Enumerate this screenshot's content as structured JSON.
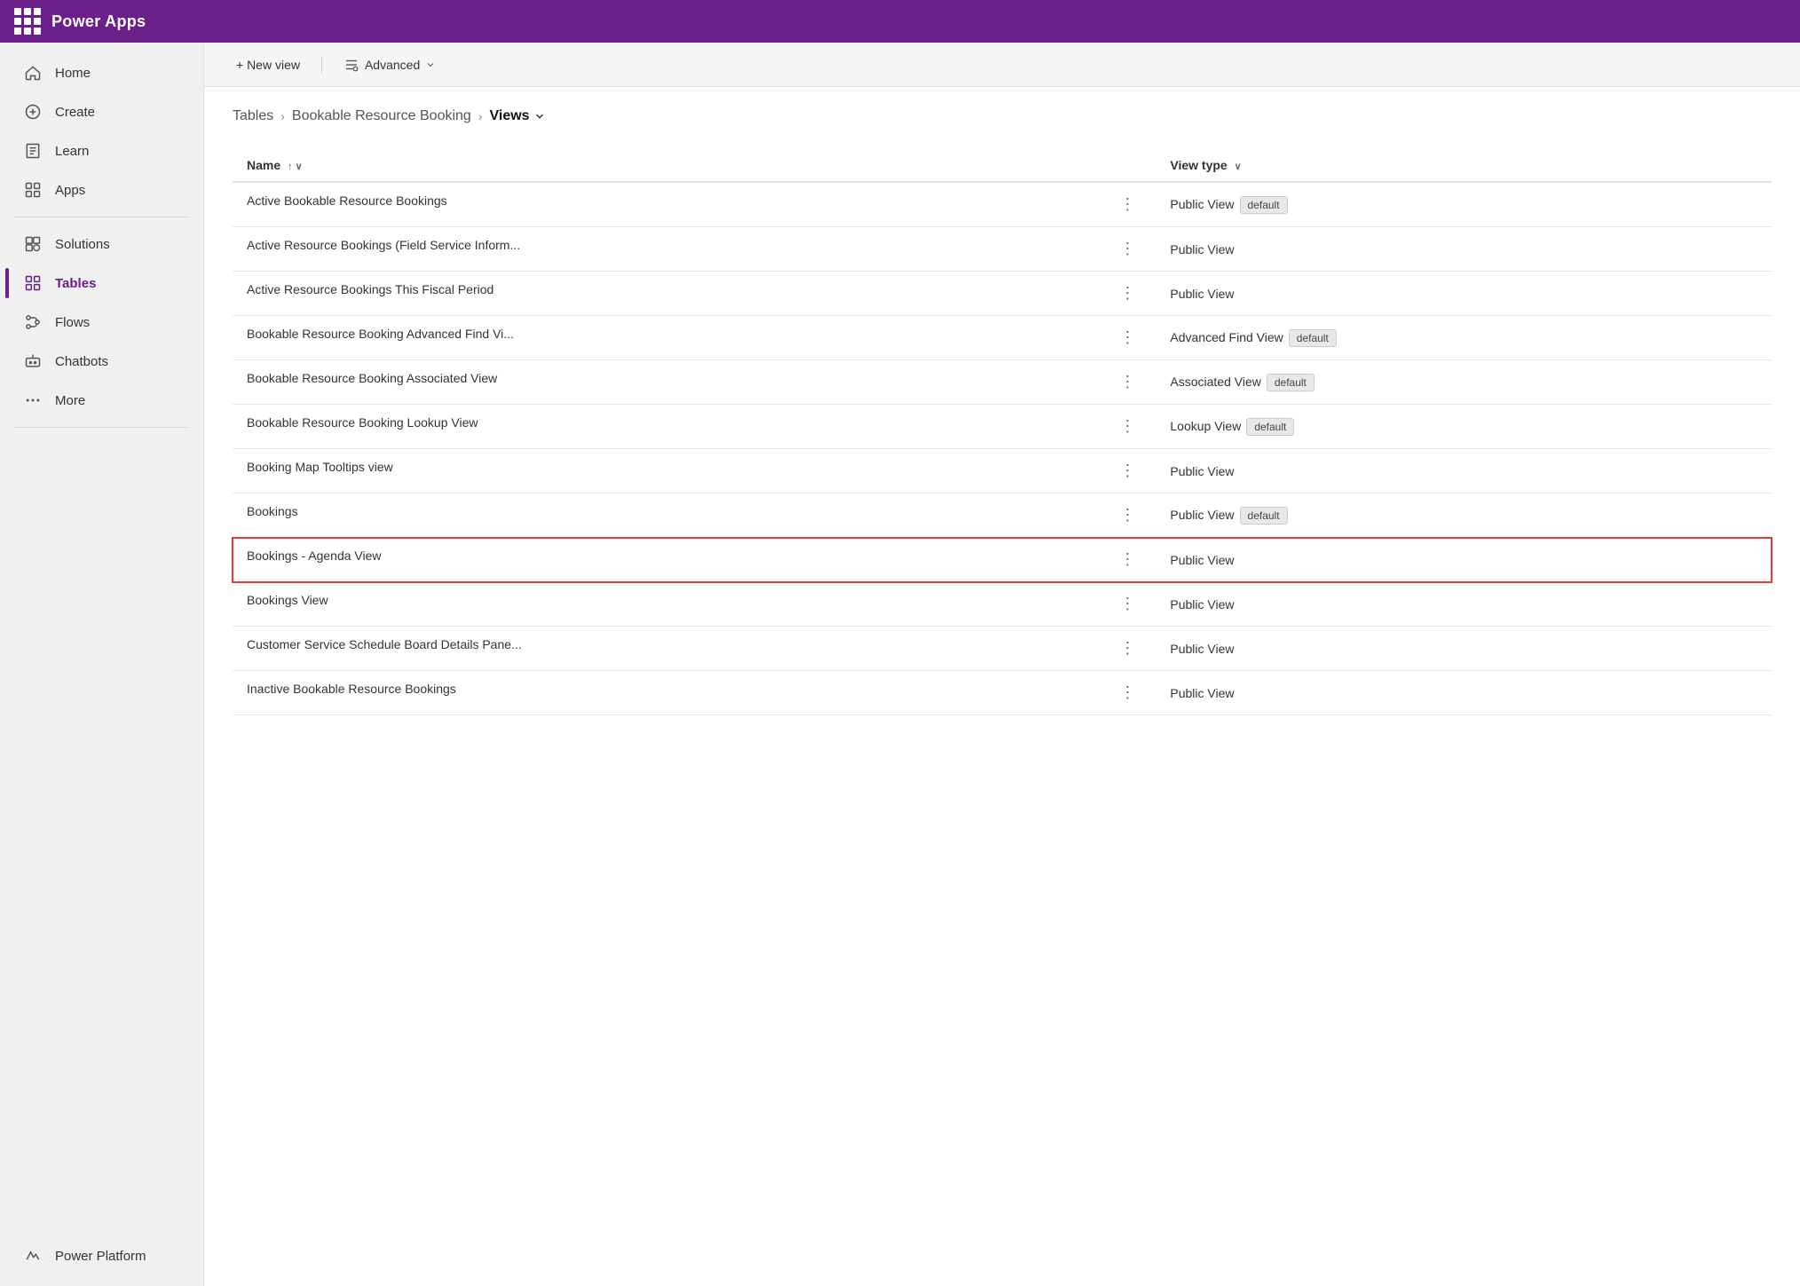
{
  "app": {
    "title": "Power Apps",
    "brand_color": "#6b1f8a"
  },
  "topbar": {
    "grid_icon": "apps-grid-icon",
    "title": "Power Apps"
  },
  "sidebar": {
    "items": [
      {
        "id": "home",
        "label": "Home",
        "icon": "home-icon",
        "active": false
      },
      {
        "id": "create",
        "label": "Create",
        "icon": "create-icon",
        "active": false
      },
      {
        "id": "learn",
        "label": "Learn",
        "icon": "learn-icon",
        "active": false
      },
      {
        "id": "apps",
        "label": "Apps",
        "icon": "apps-icon",
        "active": false
      },
      {
        "id": "solutions",
        "label": "Solutions",
        "icon": "solutions-icon",
        "active": false
      },
      {
        "id": "tables",
        "label": "Tables",
        "icon": "tables-icon",
        "active": true
      },
      {
        "id": "flows",
        "label": "Flows",
        "icon": "flows-icon",
        "active": false
      },
      {
        "id": "chatbots",
        "label": "Chatbots",
        "icon": "chatbots-icon",
        "active": false
      },
      {
        "id": "more",
        "label": "More",
        "icon": "more-icon",
        "active": false
      }
    ],
    "bottom_items": [
      {
        "id": "power-platform",
        "label": "Power Platform",
        "icon": "power-platform-icon",
        "active": false
      }
    ]
  },
  "toolbar": {
    "new_view_label": "+ New view",
    "advanced_label": "Advanced",
    "advanced_dropdown": true
  },
  "breadcrumb": {
    "items": [
      {
        "label": "Tables",
        "link": true
      },
      {
        "label": "Bookable Resource Booking",
        "link": true
      },
      {
        "label": "Views",
        "link": false,
        "dropdown": true
      }
    ]
  },
  "table": {
    "columns": [
      {
        "id": "name",
        "label": "Name",
        "sortable": true,
        "sort_indicator": "↑ ∨"
      },
      {
        "id": "view_type",
        "label": "View type",
        "sortable": true,
        "sort_indicator": "∨"
      }
    ],
    "rows": [
      {
        "id": 1,
        "name": "Active Bookable Resource Bookings",
        "view_type": "Public View",
        "badge": "default",
        "highlighted": false
      },
      {
        "id": 2,
        "name": "Active Resource Bookings (Field Service Inform...",
        "view_type": "Public View",
        "badge": null,
        "highlighted": false
      },
      {
        "id": 3,
        "name": "Active Resource Bookings This Fiscal Period",
        "view_type": "Public View",
        "badge": null,
        "highlighted": false
      },
      {
        "id": 4,
        "name": "Bookable Resource Booking Advanced Find Vi...",
        "view_type": "Advanced Find View",
        "badge": "default",
        "highlighted": false
      },
      {
        "id": 5,
        "name": "Bookable Resource Booking Associated View",
        "view_type": "Associated View",
        "badge": "default",
        "highlighted": false
      },
      {
        "id": 6,
        "name": "Bookable Resource Booking Lookup View",
        "view_type": "Lookup View",
        "badge": "default",
        "highlighted": false
      },
      {
        "id": 7,
        "name": "Booking Map Tooltips view",
        "view_type": "Public View",
        "badge": null,
        "highlighted": false
      },
      {
        "id": 8,
        "name": "Bookings",
        "view_type": "Public View",
        "badge": "default",
        "highlighted": false
      },
      {
        "id": 9,
        "name": "Bookings - Agenda View",
        "view_type": "Public View",
        "badge": null,
        "highlighted": true
      },
      {
        "id": 10,
        "name": "Bookings View",
        "view_type": "Public View",
        "badge": null,
        "highlighted": false
      },
      {
        "id": 11,
        "name": "Customer Service Schedule Board Details Pane...",
        "view_type": "Public View",
        "badge": null,
        "highlighted": false
      },
      {
        "id": 12,
        "name": "Inactive Bookable Resource Bookings",
        "view_type": "Public View",
        "badge": null,
        "highlighted": false
      }
    ]
  }
}
